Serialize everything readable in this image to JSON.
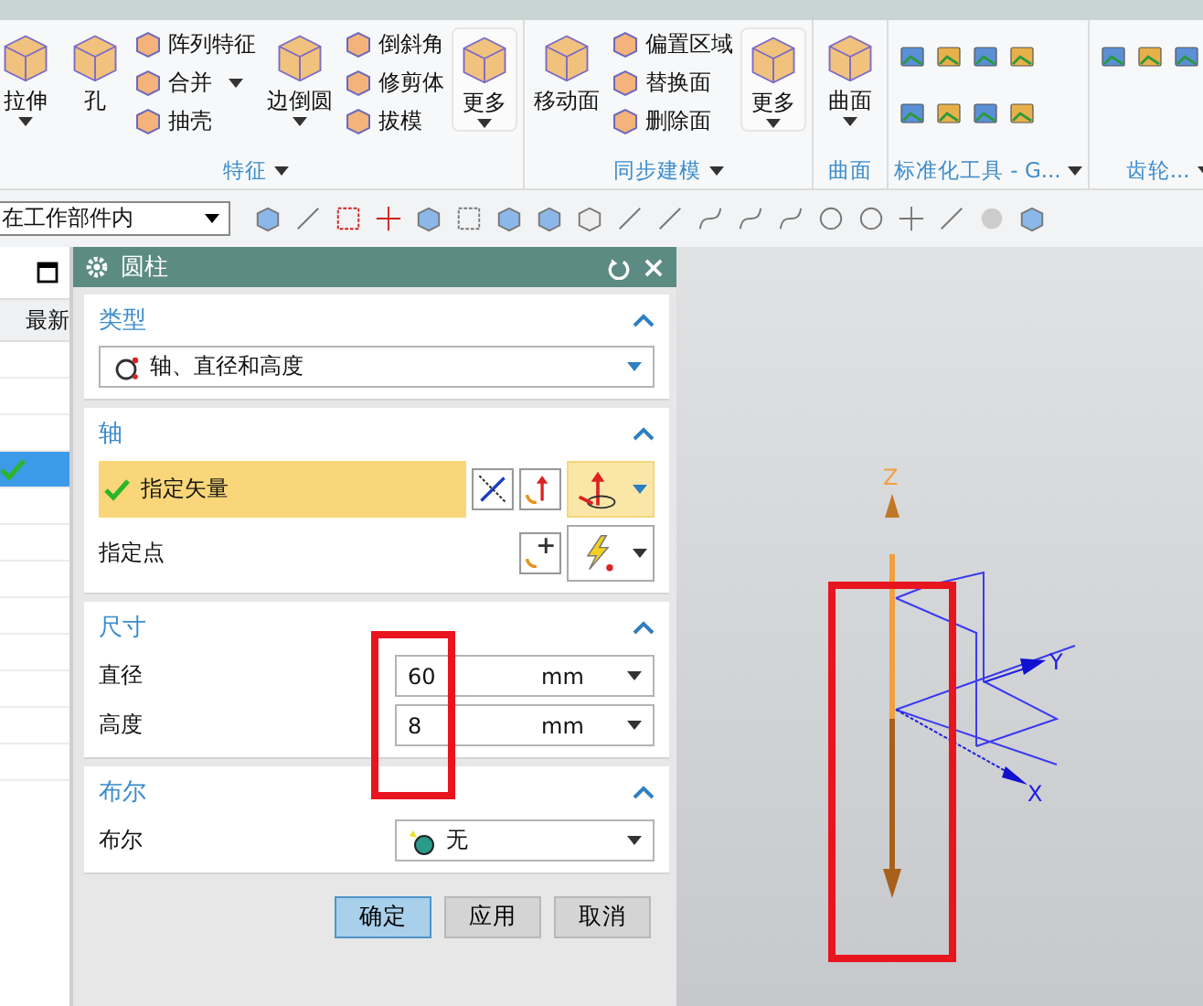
{
  "ribbon": {
    "groups": [
      {
        "label": "特征",
        "kind": "tools",
        "launcher": true,
        "columns": [
          {
            "kind": "large",
            "label": "拉伸",
            "dropdown": true,
            "boxed": false
          },
          {
            "kind": "large",
            "label": "孔",
            "dropdown": false,
            "boxed": false
          },
          {
            "kind": "stack",
            "items": [
              {
                "label": "阵列特征",
                "dropdown": false
              },
              {
                "label": "合并",
                "dropdown": true
              },
              {
                "label": "抽壳",
                "dropdown": false
              }
            ]
          },
          {
            "kind": "large",
            "label": "边倒圆",
            "dropdown": true,
            "boxed": false
          },
          {
            "kind": "stack",
            "items": [
              {
                "label": "倒斜角",
                "dropdown": false
              },
              {
                "label": "修剪体",
                "dropdown": false
              },
              {
                "label": "拔模",
                "dropdown": false
              }
            ]
          },
          {
            "kind": "large",
            "label": "更多",
            "dropdown": true,
            "boxed": true
          }
        ]
      },
      {
        "label": "同步建模",
        "kind": "tools",
        "launcher": true,
        "columns": [
          {
            "kind": "large",
            "label": "移动面",
            "dropdown": false,
            "boxed": false
          },
          {
            "kind": "stack",
            "items": [
              {
                "label": "偏置区域",
                "dropdown": false
              },
              {
                "label": "替换面",
                "dropdown": false
              },
              {
                "label": "删除面",
                "dropdown": false
              }
            ]
          },
          {
            "kind": "large",
            "label": "更多",
            "dropdown": true,
            "boxed": true
          }
        ]
      },
      {
        "label": "曲面",
        "kind": "tools",
        "launcher": false,
        "columns": [
          {
            "kind": "large",
            "label": "曲面",
            "dropdown": true,
            "boxed": false
          }
        ]
      },
      {
        "label": "标准化工具 - G...",
        "kind": "icons",
        "launcher": true
      },
      {
        "label": "齿轮...",
        "kind": "icons",
        "launcher": true
      }
    ]
  },
  "toolbar": {
    "scope": {
      "value": "在工作部件内"
    }
  },
  "navigator": {
    "header": "最新",
    "rows": [
      {
        "selected": false,
        "checked": false
      },
      {
        "selected": false,
        "checked": false
      },
      {
        "selected": false,
        "checked": false
      },
      {
        "selected": true,
        "checked": true
      },
      {
        "selected": false,
        "checked": false
      },
      {
        "selected": false,
        "checked": false
      },
      {
        "selected": false,
        "checked": false
      },
      {
        "selected": false,
        "checked": false
      },
      {
        "selected": false,
        "checked": false
      },
      {
        "selected": false,
        "checked": false
      },
      {
        "selected": false,
        "checked": false
      },
      {
        "selected": false,
        "checked": false
      }
    ]
  },
  "dialog": {
    "title": "圆柱",
    "sections": [
      {
        "kind": "type",
        "title": "类型",
        "expanded": true,
        "value": "轴、直径和高度"
      },
      {
        "kind": "axis",
        "title": "轴",
        "expanded": true,
        "vector": {
          "label": "指定矢量",
          "selected": true,
          "checked": true
        },
        "point": {
          "label": "指定点"
        }
      },
      {
        "kind": "dims",
        "title": "尺寸",
        "expanded": true,
        "fields": [
          {
            "label": "直径",
            "value": "60",
            "unit": "mm"
          },
          {
            "label": "高度",
            "value": "8",
            "unit": "mm"
          }
        ]
      },
      {
        "kind": "bool",
        "title": "布尔",
        "expanded": true,
        "label": "布尔",
        "value": "无"
      }
    ],
    "buttons": [
      {
        "label": "确定",
        "selected": true
      },
      {
        "label": "应用",
        "selected": false
      },
      {
        "label": "取消",
        "selected": false
      }
    ]
  },
  "viewport": {
    "triad": {
      "z_label": "Z",
      "y_label": "Y",
      "x_label": "X"
    }
  }
}
